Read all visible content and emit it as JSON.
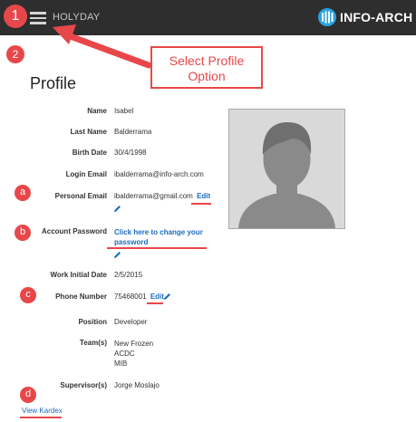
{
  "header": {
    "app_title": "HOLYDAY",
    "logo_text": "INFO-ARCH"
  },
  "annotations": {
    "step1": "1",
    "step2": "2",
    "callout_line1": "Select Profile",
    "callout_line2": "Option",
    "marker_a": "a",
    "marker_b": "b",
    "marker_c": "c",
    "marker_d": "d",
    "color": "#e8474a"
  },
  "profile": {
    "title": "Profile",
    "fields": {
      "name": {
        "label": "Name",
        "value": "Isabel"
      },
      "last_name": {
        "label": "Last Name",
        "value": "Balderrama"
      },
      "birth_date": {
        "label": "Birth Date",
        "value": "30/4/1998"
      },
      "login_email": {
        "label": "Login Email",
        "value": "ibalderrama@info-arch.com"
      },
      "personal_email": {
        "label": "Personal Email",
        "value": "ibalderrama@gmail.com",
        "edit_label": "Edit"
      },
      "account_password": {
        "label": "Account Password",
        "link_line1": "Click here to change your",
        "link_line2": "password"
      },
      "work_initial_date": {
        "label": "Work Initial Date",
        "value": "2/5/2015"
      },
      "phone_number": {
        "label": "Phone Number",
        "value": "75468001",
        "edit_label": "Edit"
      },
      "position": {
        "label": "Position",
        "value": "Developer"
      },
      "teams": {
        "label": "Team(s)",
        "values": [
          "New Frozen",
          "ACDC",
          "MIB"
        ]
      },
      "supervisors": {
        "label": "Supervisor(s)",
        "value": "Jorge Moslajo"
      }
    },
    "view_kardex": "View Kardex"
  },
  "icons": {
    "menu": "hamburger-menu-icon",
    "pencil": "pencil-icon",
    "avatar": "user-avatar-placeholder"
  },
  "colors": {
    "topbar": "#2e2e2e",
    "link": "#1a6bbf",
    "annotation": "#e8474a"
  }
}
